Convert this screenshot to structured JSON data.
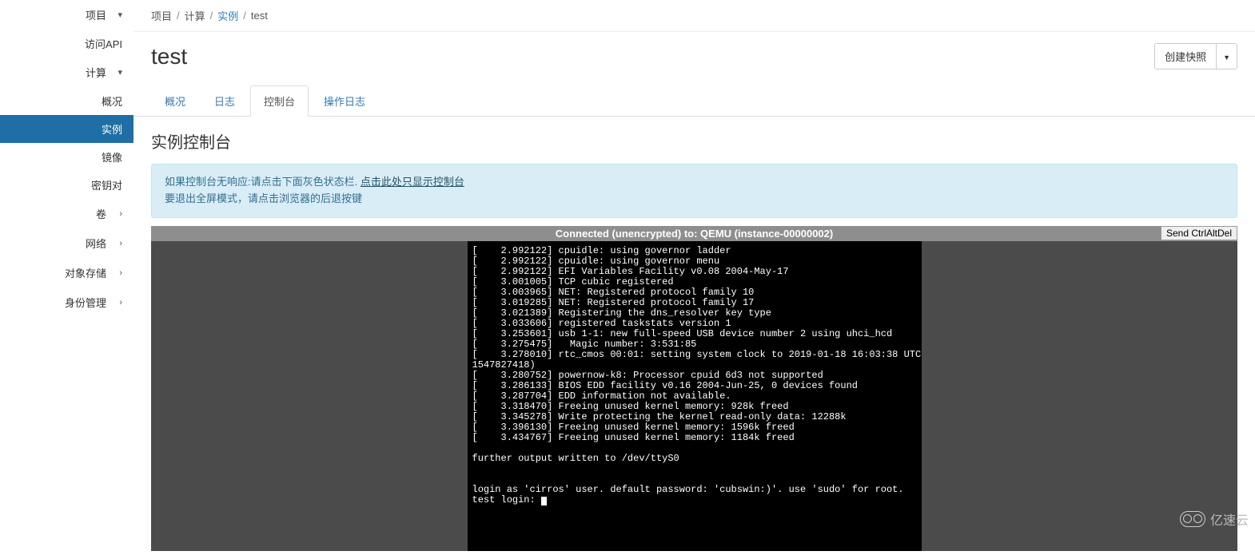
{
  "sidebar": {
    "project": "项目",
    "api": "访问API",
    "compute": "计算",
    "compute_children": {
      "overview": "概况",
      "instances": "实例",
      "images": "镜像",
      "keypairs": "密钥对"
    },
    "volumes": "卷",
    "network": "网络",
    "object_storage": "对象存储",
    "identity": "身份管理"
  },
  "breadcrumb": {
    "p1": "项目",
    "p2": "计算",
    "p3": "实例",
    "p4": "test"
  },
  "page": {
    "title": "test",
    "snapshot_btn": "创建快照",
    "caret": "▼"
  },
  "tabs": {
    "overview": "概况",
    "log": "日志",
    "console": "控制台",
    "action_log": "操作日志"
  },
  "section": {
    "title": "实例控制台"
  },
  "alert": {
    "line1_pre": "如果控制台无响应:请点击下面灰色状态栏.",
    "line1_link": "点击此处只显示控制台",
    "line2": "要退出全屏模式，请点击浏览器的后退按键"
  },
  "console": {
    "status": "Connected (unencrypted) to: QEMU (instance-00000002)",
    "send_btn": "Send CtrlAltDel",
    "lines": [
      "[    2.992122] cpuidle: using governor ladder",
      "[    2.992122] cpuidle: using governor menu",
      "[    2.992122] EFI Variables Facility v0.08 2004-May-17",
      "[    3.001005] TCP cubic registered",
      "[    3.003965] NET: Registered protocol family 10",
      "[    3.019285] NET: Registered protocol family 17",
      "[    3.021389] Registering the dns_resolver key type",
      "[    3.033606] registered taskstats version 1",
      "[    3.253601] usb 1-1: new full-speed USB device number 2 using uhci_hcd",
      "[    3.275475]   Magic number: 3:531:85",
      "[    3.278010] rtc_cmos 00:01: setting system clock to 2019-01-18 16:03:38 UTC (",
      "1547827418)",
      "[    3.280752] powernow-k8: Processor cpuid 6d3 not supported",
      "[    3.286133] BIOS EDD facility v0.16 2004-Jun-25, 0 devices found",
      "[    3.287704] EDD information not available.",
      "[    3.318470] Freeing unused kernel memory: 928k freed",
      "[    3.345278] Write protecting the kernel read-only data: 12288k",
      "[    3.396130] Freeing unused kernel memory: 1596k freed",
      "[    3.434767] Freeing unused kernel memory: 1184k freed",
      "",
      "further output written to /dev/ttyS0",
      "",
      "",
      "login as 'cirros' user. default password: 'cubswin:)'. use 'sudo' for root.",
      "test login: "
    ]
  },
  "watermark": {
    "text": "亿速云"
  }
}
